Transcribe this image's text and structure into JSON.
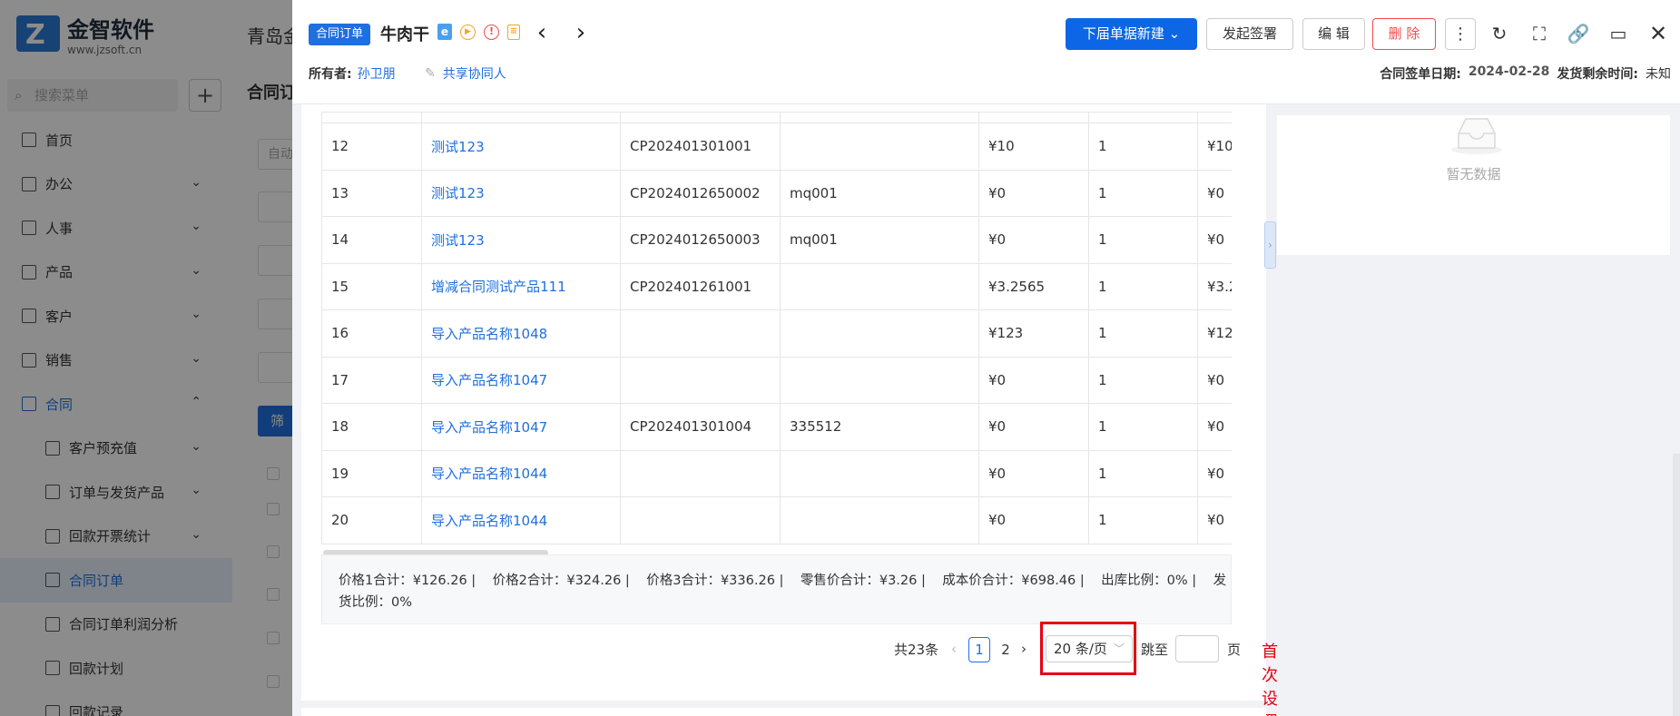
{
  "app": {
    "logo_name": "金智软件",
    "logo_url": "www.jzsoft.cn",
    "company": "青岛金",
    "search_placeholder": "搜索菜单",
    "page_title": "合同订",
    "bg_field_text": "自动",
    "bg_button": "筛",
    "menu": [
      {
        "label": "首页",
        "chevron": ""
      },
      {
        "label": "办公",
        "chevron": "⌄"
      },
      {
        "label": "人事",
        "chevron": "⌄"
      },
      {
        "label": "产品",
        "chevron": "⌄"
      },
      {
        "label": "客户",
        "chevron": "⌄"
      },
      {
        "label": "销售",
        "chevron": "⌄"
      },
      {
        "label": "合同",
        "chevron": "⌃"
      },
      {
        "label": "客户预充值",
        "chevron": "⌄"
      },
      {
        "label": "订单与发货产品",
        "chevron": "⌄"
      },
      {
        "label": "回款开票统计",
        "chevron": "⌄"
      },
      {
        "label": "合同订单",
        "chevron": ""
      },
      {
        "label": "合同订单利润分析",
        "chevron": ""
      },
      {
        "label": "回款计划",
        "chevron": ""
      },
      {
        "label": "回款记录",
        "chevron": ""
      }
    ]
  },
  "drawer": {
    "tag": "合同订单",
    "title": "牛肉干",
    "owner_label": "所有者:",
    "owner_name": "孙卫朋",
    "share_label": "共享协同人",
    "buttons": {
      "create_downstream": "下届单据新建",
      "sign": "发起签署",
      "edit": "编 辑",
      "delete": "删 除"
    },
    "sign_date_label": "合同签单日期:",
    "sign_date": "2024-02-28",
    "remaining_label": "发货剩余时间:",
    "remaining": "未知"
  },
  "table": {
    "rows": [
      {
        "no": "12",
        "name": "测试123",
        "code": "CP202401301001",
        "spec": "",
        "price": "¥10",
        "qty": "1",
        "extra": "¥10"
      },
      {
        "no": "13",
        "name": "测试123",
        "code": "CP2024012650002",
        "spec": "mq001",
        "price": "¥0",
        "qty": "1",
        "extra": "¥0"
      },
      {
        "no": "14",
        "name": "测试123",
        "code": "CP2024012650003",
        "spec": "mq001",
        "price": "¥0",
        "qty": "1",
        "extra": "¥0"
      },
      {
        "no": "15",
        "name": "增减合同测试产品111",
        "code": "CP202401261001",
        "spec": "",
        "price": "¥3.2565",
        "qty": "1",
        "extra": "¥3.2"
      },
      {
        "no": "16",
        "name": "导入产品名称1048",
        "code": "",
        "spec": "",
        "price": "¥123",
        "qty": "1",
        "extra": "¥12"
      },
      {
        "no": "17",
        "name": "导入产品名称1047",
        "code": "",
        "spec": "",
        "price": "¥0",
        "qty": "1",
        "extra": "¥0"
      },
      {
        "no": "18",
        "name": "导入产品名称1047",
        "code": "CP202401301004",
        "spec": "335512",
        "price": "¥0",
        "qty": "1",
        "extra": "¥0"
      },
      {
        "no": "19",
        "name": "导入产品名称1044",
        "code": "",
        "spec": "",
        "price": "¥0",
        "qty": "1",
        "extra": "¥0"
      },
      {
        "no": "20",
        "name": "导入产品名称1044",
        "code": "",
        "spec": "",
        "price": "¥0",
        "qty": "1",
        "extra": "¥0"
      }
    ]
  },
  "totals": {
    "line1": "价格1合计：¥126.26 |    价格2合计：¥324.26 |    价格3合计：¥336.26 |    零售价合计：¥3.26 |    成本价合计：¥698.46 |    出库比例：0% |    发",
    "line2": "货比例：0%"
  },
  "pagination": {
    "total": "共23条",
    "pages": [
      "1",
      "2"
    ],
    "page_size": "20 条/页",
    "jump_label": "跳至",
    "page_unit": "页"
  },
  "annotation": "首次设置",
  "empty": {
    "text": "暂无数据"
  }
}
